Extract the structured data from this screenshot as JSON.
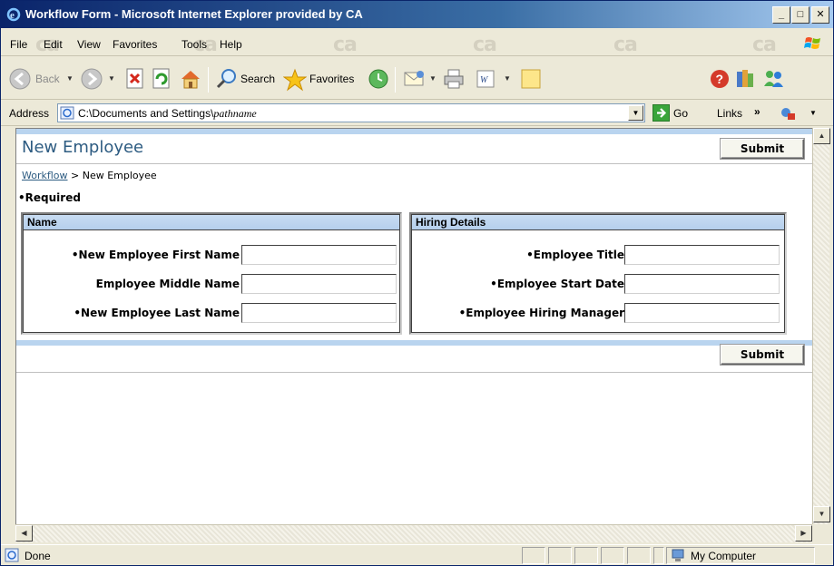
{
  "window": {
    "title": "Workflow Form - Microsoft Internet Explorer provided by CA",
    "min_glyph": "_",
    "max_glyph": "□",
    "close_glyph": "✕"
  },
  "menu": {
    "items": [
      "File",
      "Edit",
      "View",
      "Favorites",
      "Tools",
      "Help"
    ],
    "watermark": "ca"
  },
  "toolbar": {
    "back_label": "Back",
    "search_label": "Search",
    "favorites_label": "Favorites"
  },
  "address": {
    "label": "Address",
    "path_prefix": "C:\\Documents and Settings\\",
    "path_name": "pathname",
    "go_label": "Go",
    "links_label": "Links",
    "links_chevron": "»"
  },
  "page": {
    "title": "New Employee",
    "submit_label": "Submit",
    "breadcrumb": {
      "link": "Workflow",
      "separator": ">",
      "current": "New Employee"
    },
    "required_note": "•Required",
    "name_section": {
      "title": "Name",
      "fields": [
        {
          "label": "•New Employee First Name",
          "value": ""
        },
        {
          "label": "Employee Middle Name",
          "value": ""
        },
        {
          "label": "•New Employee Last Name",
          "value": ""
        }
      ]
    },
    "hiring_section": {
      "title": "Hiring Details",
      "fields": [
        {
          "label": "•Employee Title",
          "value": ""
        },
        {
          "label": "•Employee Start Date",
          "value": ""
        },
        {
          "label": "•Employee Hiring Manager",
          "value": ""
        }
      ]
    }
  },
  "status": {
    "text": "Done",
    "zone": "My Computer"
  },
  "colors": {
    "page_title": "#2e5c82",
    "band": "#b9d4ef",
    "titlebar_start": "#0a246a"
  }
}
